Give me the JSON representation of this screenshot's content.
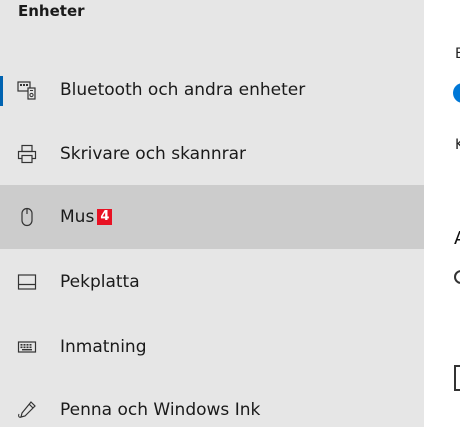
{
  "sidebar": {
    "section_title": "Enheter",
    "items": [
      {
        "label": "Bluetooth och andra enheter",
        "icon": "bluetooth-devices-icon"
      },
      {
        "label": "Skrivare och skannrar",
        "icon": "printer-icon"
      },
      {
        "label": "Mus",
        "icon": "mouse-icon",
        "badge": "4",
        "selected": true
      },
      {
        "label": "Pekplatta",
        "icon": "touchpad-icon"
      },
      {
        "label": "Inmatning",
        "icon": "keyboard-icon"
      },
      {
        "label": "Penna och Windows Ink",
        "icon": "pen-icon"
      }
    ]
  },
  "right_pane": {
    "partial_text_1": "E",
    "partial_text_2": "K",
    "partial_heading": "A"
  },
  "colors": {
    "sidebar_bg": "#e6e6e6",
    "selected_bg": "#cccccc",
    "accent": "#0063b1",
    "badge": "#e81123"
  }
}
